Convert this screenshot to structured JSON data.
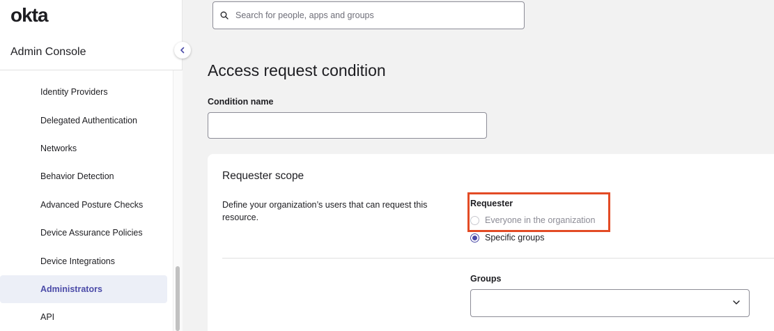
{
  "brand": {
    "logo": "okta",
    "console_title": "Admin Console"
  },
  "sidebar": {
    "items": [
      {
        "label": "Identity Providers",
        "active": false
      },
      {
        "label": "Delegated Authentication",
        "active": false
      },
      {
        "label": "Networks",
        "active": false
      },
      {
        "label": "Behavior Detection",
        "active": false
      },
      {
        "label": "Advanced Posture Checks",
        "active": false
      },
      {
        "label": "Device Assurance Policies",
        "active": false
      },
      {
        "label": "Device Integrations",
        "active": false
      },
      {
        "label": "Administrators",
        "active": true
      },
      {
        "label": "API",
        "active": false
      }
    ]
  },
  "search": {
    "placeholder": "Search for people, apps and groups",
    "value": ""
  },
  "page": {
    "title": "Access request condition",
    "condition_name_label": "Condition name",
    "condition_name_value": ""
  },
  "requester_scope": {
    "title": "Requester scope",
    "description": "Define your organization’s users that can request this resource.",
    "requester_label": "Requester",
    "options": [
      {
        "label": "Everyone in the organization",
        "checked": false,
        "disabled": true
      },
      {
        "label": "Specific groups",
        "checked": true,
        "disabled": false
      }
    ],
    "groups_label": "Groups",
    "groups_value": ""
  },
  "colors": {
    "accent": "#4b4ba8",
    "highlight": "#e34b25",
    "active_bg": "#eceff7"
  }
}
